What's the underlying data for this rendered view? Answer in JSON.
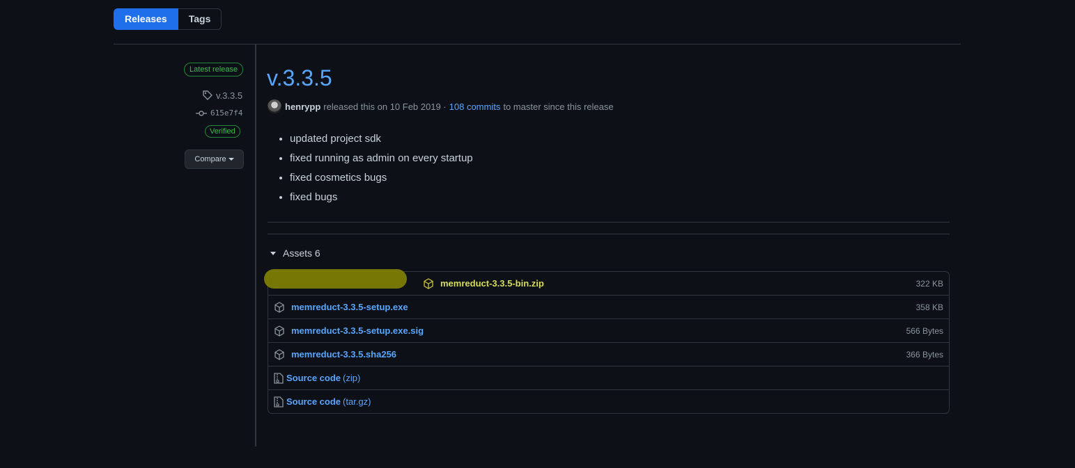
{
  "tabs": [
    {
      "label": "Releases",
      "active": true
    },
    {
      "label": "Tags",
      "active": false
    }
  ],
  "meta": {
    "latest_label": "Latest release",
    "tag": "v.3.3.5",
    "commit": "615e7f4",
    "verified_label": "Verified",
    "compare_label": "Compare"
  },
  "release": {
    "title": "v.3.3.5",
    "author": "henrypp",
    "released_text": "released this on 10 Feb 2019 ·",
    "commits_link": "108 commits",
    "since_text": "to master since this release",
    "notes": [
      "updated project sdk",
      "fixed running as admin on every startup",
      "fixed cosmetics bugs",
      "fixed bugs"
    ]
  },
  "assets": {
    "header": "Assets",
    "count": "6",
    "items": [
      {
        "name": "memreduct-3.3.5-bin.zip",
        "size": "322 KB"
      },
      {
        "name": "memreduct-3.3.5-setup.exe",
        "size": "358 KB"
      },
      {
        "name": "memreduct-3.3.5-setup.exe.sig",
        "size": "566 Bytes"
      },
      {
        "name": "memreduct-3.3.5.sha256",
        "size": "366 Bytes"
      }
    ],
    "source": [
      {
        "name": "Source code",
        "format": "(zip)"
      },
      {
        "name": "Source code",
        "format": "(tar.gz)"
      }
    ]
  },
  "colors": {
    "accent": "#58a6ff",
    "primary_button": "#1f6feb",
    "verified": "#3fb950",
    "highlight": "#8a8a00"
  }
}
